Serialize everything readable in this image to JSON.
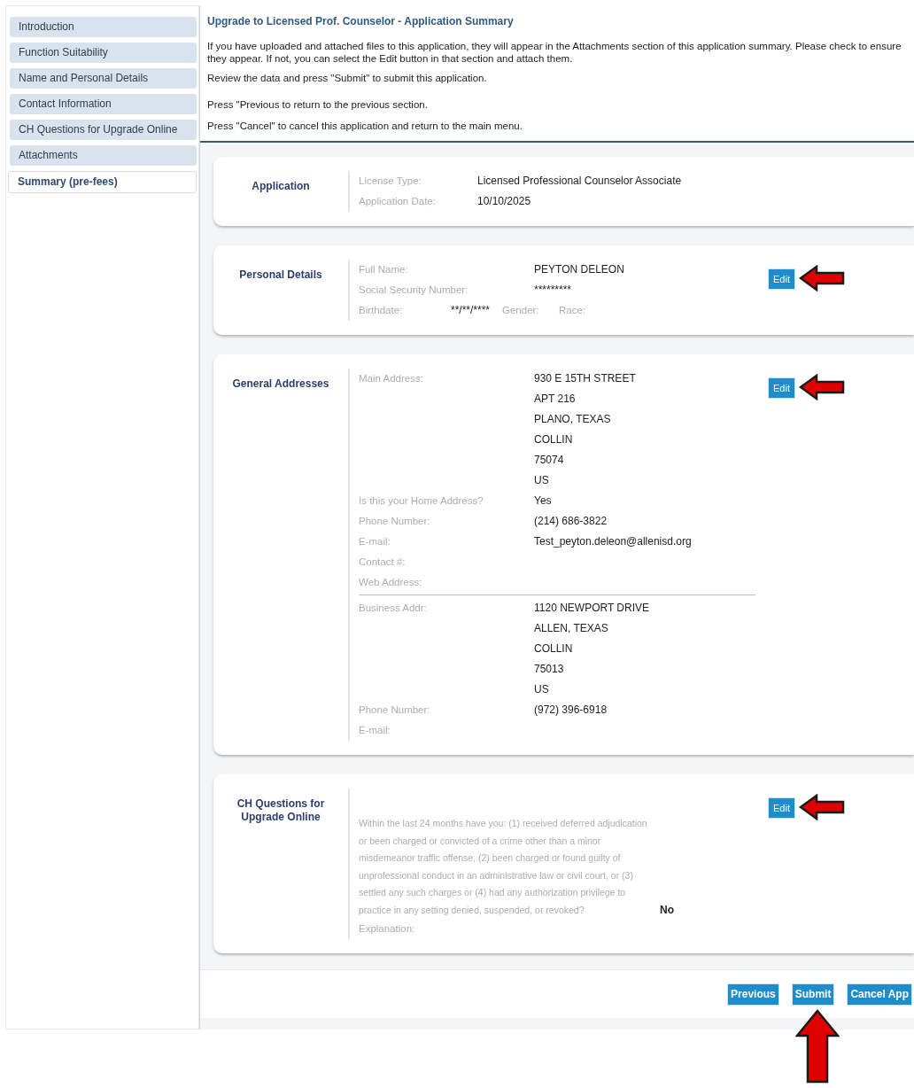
{
  "sidebar": {
    "items": [
      {
        "label": "Introduction",
        "selected": false
      },
      {
        "label": "Function Suitability",
        "selected": false
      },
      {
        "label": "Name and Personal Details",
        "selected": false
      },
      {
        "label": "Contact Information",
        "selected": false
      },
      {
        "label": "CH Questions for Upgrade Online",
        "selected": false
      },
      {
        "label": "Attachments",
        "selected": false
      },
      {
        "label": "Summary (pre-fees)",
        "selected": true
      }
    ]
  },
  "header": {
    "title": "Upgrade to Licensed Prof. Counselor - Application Summary",
    "paragraphs": [
      "If you have uploaded and attached files to this application, they will appear in the Attachments section of this application summary. Please check to ensure they appear. If not, you can select the Edit button in that section and attach them.",
      "Review the data and press \"Submit\" to submit this application.",
      "Press \"Previous to return to the previous section.",
      "Press \"Cancel\" to cancel this application and return to the main menu."
    ]
  },
  "sections": [
    {
      "kind": "fields",
      "title": "Application",
      "rows": [
        {
          "label": "License Type:",
          "value": "Licensed Professional Counselor Associate"
        },
        {
          "label": "Application Date:",
          "value": "10/10/2025"
        }
      ]
    },
    {
      "kind": "fields",
      "title": "Personal Details",
      "edit": {
        "label": "Edit",
        "annotation_arrow": true
      },
      "rows": [
        {
          "label": "Full Name:",
          "value": "PEYTON  DELEON"
        },
        {
          "label": "Social Security Number:",
          "value": "*********"
        }
      ],
      "inline_row": [
        {
          "label": "Birthdate:",
          "value": "**/**/****"
        },
        {
          "label": "Gender:"
        },
        {
          "label": "Race:"
        }
      ]
    },
    {
      "kind": "addresses",
      "title": "General Addresses",
      "edit": {
        "label": "Edit",
        "annotation_arrow": true
      },
      "groups": [
        {
          "rows": [
            {
              "label": "Main Address:",
              "lines": [
                "930 E 15TH STREET",
                "APT 216",
                "PLANO, TEXAS",
                "COLLIN",
                "75074",
                "US"
              ]
            },
            {
              "label": "Is this your Home Address?",
              "lines": [
                "Yes"
              ]
            },
            {
              "label": "Phone Number:",
              "lines": [
                "(214) 686-3822"
              ]
            },
            {
              "label": "E-mail:",
              "lines": [
                "Test_peyton.deleon@allenisd.org"
              ]
            },
            {
              "label": "Contact #:"
            },
            {
              "label": "Web Address:"
            }
          ]
        },
        {
          "rows": [
            {
              "label": "Business Addr:",
              "lines": [
                "1120 NEWPORT DRIVE",
                "ALLEN, TEXAS",
                "COLLIN",
                "75013",
                "US"
              ]
            },
            {
              "label": "Phone Number:",
              "lines": [
                "(972) 396-6918"
              ]
            },
            {
              "label": "E-mail:"
            }
          ]
        }
      ]
    },
    {
      "kind": "question",
      "title": "CH Questions for Upgrade Online",
      "edit": {
        "label": "Edit",
        "annotation_arrow": true
      },
      "question": "Within the last 24 months have you: (1) received deferred adjudication or been charged or convicted of a crime other than a minor misdemeanor traffic offense, (2) been charged or found guilty of unprofessional conduct in an administrative law or civil court, or (3) settled any such charges or (4) had any authorization privilege to practice in any setting denied, suspended, or revoked?",
      "answer": "No",
      "extra_label": "Explanation:"
    }
  ],
  "buttons": [
    {
      "label": "Previous"
    },
    {
      "label": "Submit",
      "annotation_arrow": true
    },
    {
      "label": "Cancel App"
    }
  ]
}
